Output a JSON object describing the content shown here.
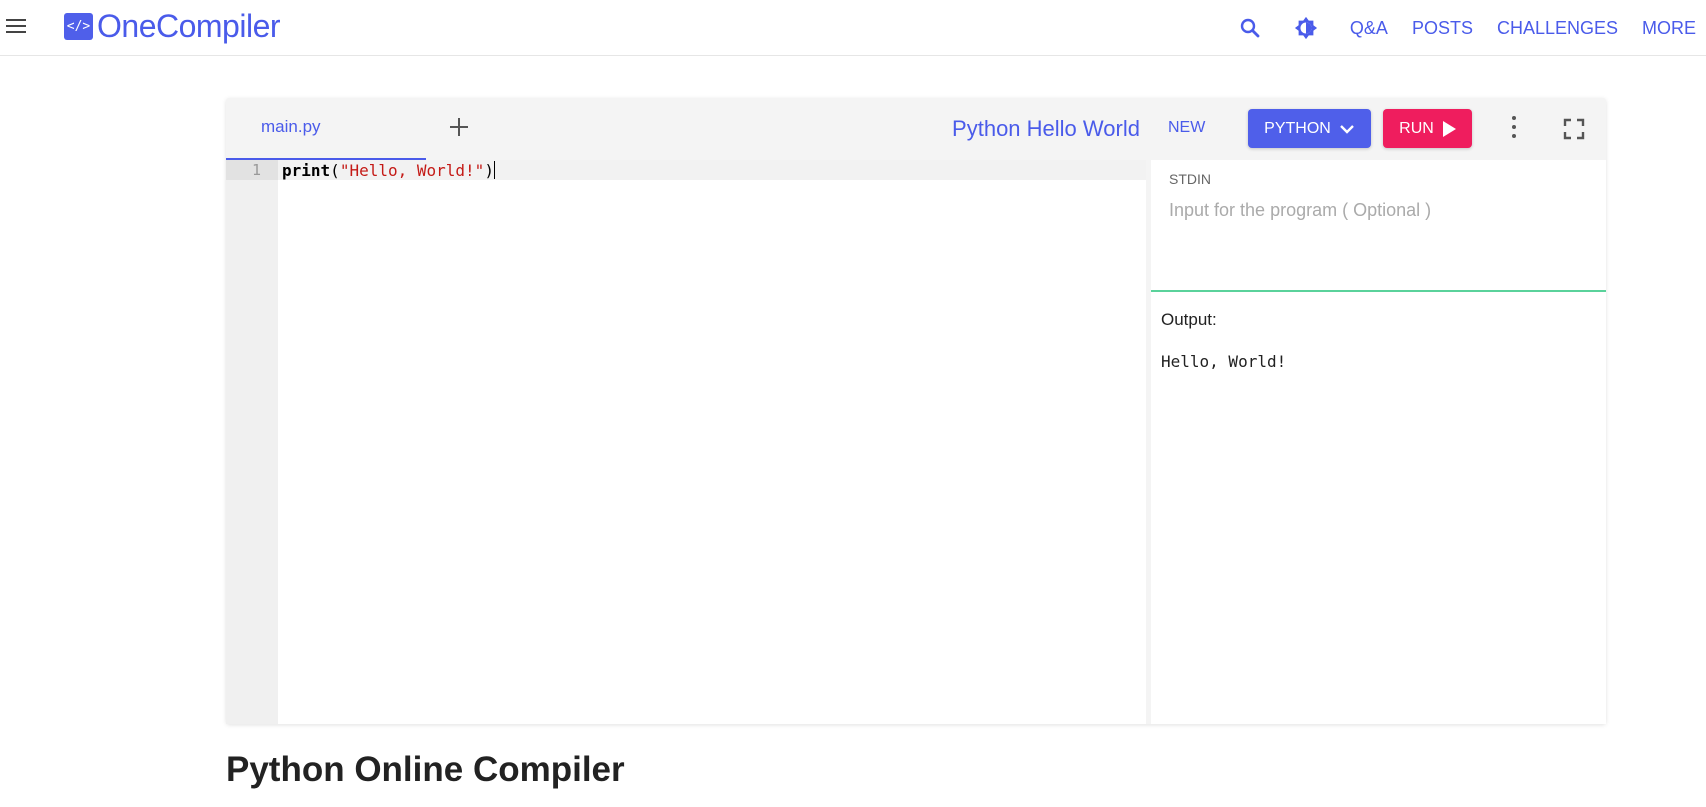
{
  "app": {
    "logo_symbol": "</>",
    "logo_text": "OneCompiler",
    "brand_color": "#4f5fea"
  },
  "nav": {
    "icons": [
      "search-icon",
      "theme-toggle-icon"
    ],
    "links": [
      "Q&A",
      "POSTS",
      "CHALLENGES",
      "MORE"
    ]
  },
  "editor": {
    "file_tab": "main.py",
    "title": "Python Hello World",
    "new_label": "NEW",
    "language_label": "PYTHON",
    "run_label": "RUN",
    "run_color": "#ef1d5e",
    "line_number": "1",
    "code": {
      "func": "print",
      "open": "(",
      "string": "\"Hello, World!\"",
      "close": ")"
    }
  },
  "io": {
    "stdin_label": "STDIN",
    "stdin_placeholder": "Input for the program ( Optional )",
    "stdin_value": "",
    "output_label": "Output:",
    "output_text": "Hello, World!"
  },
  "page": {
    "heading": "Python Online Compiler"
  }
}
